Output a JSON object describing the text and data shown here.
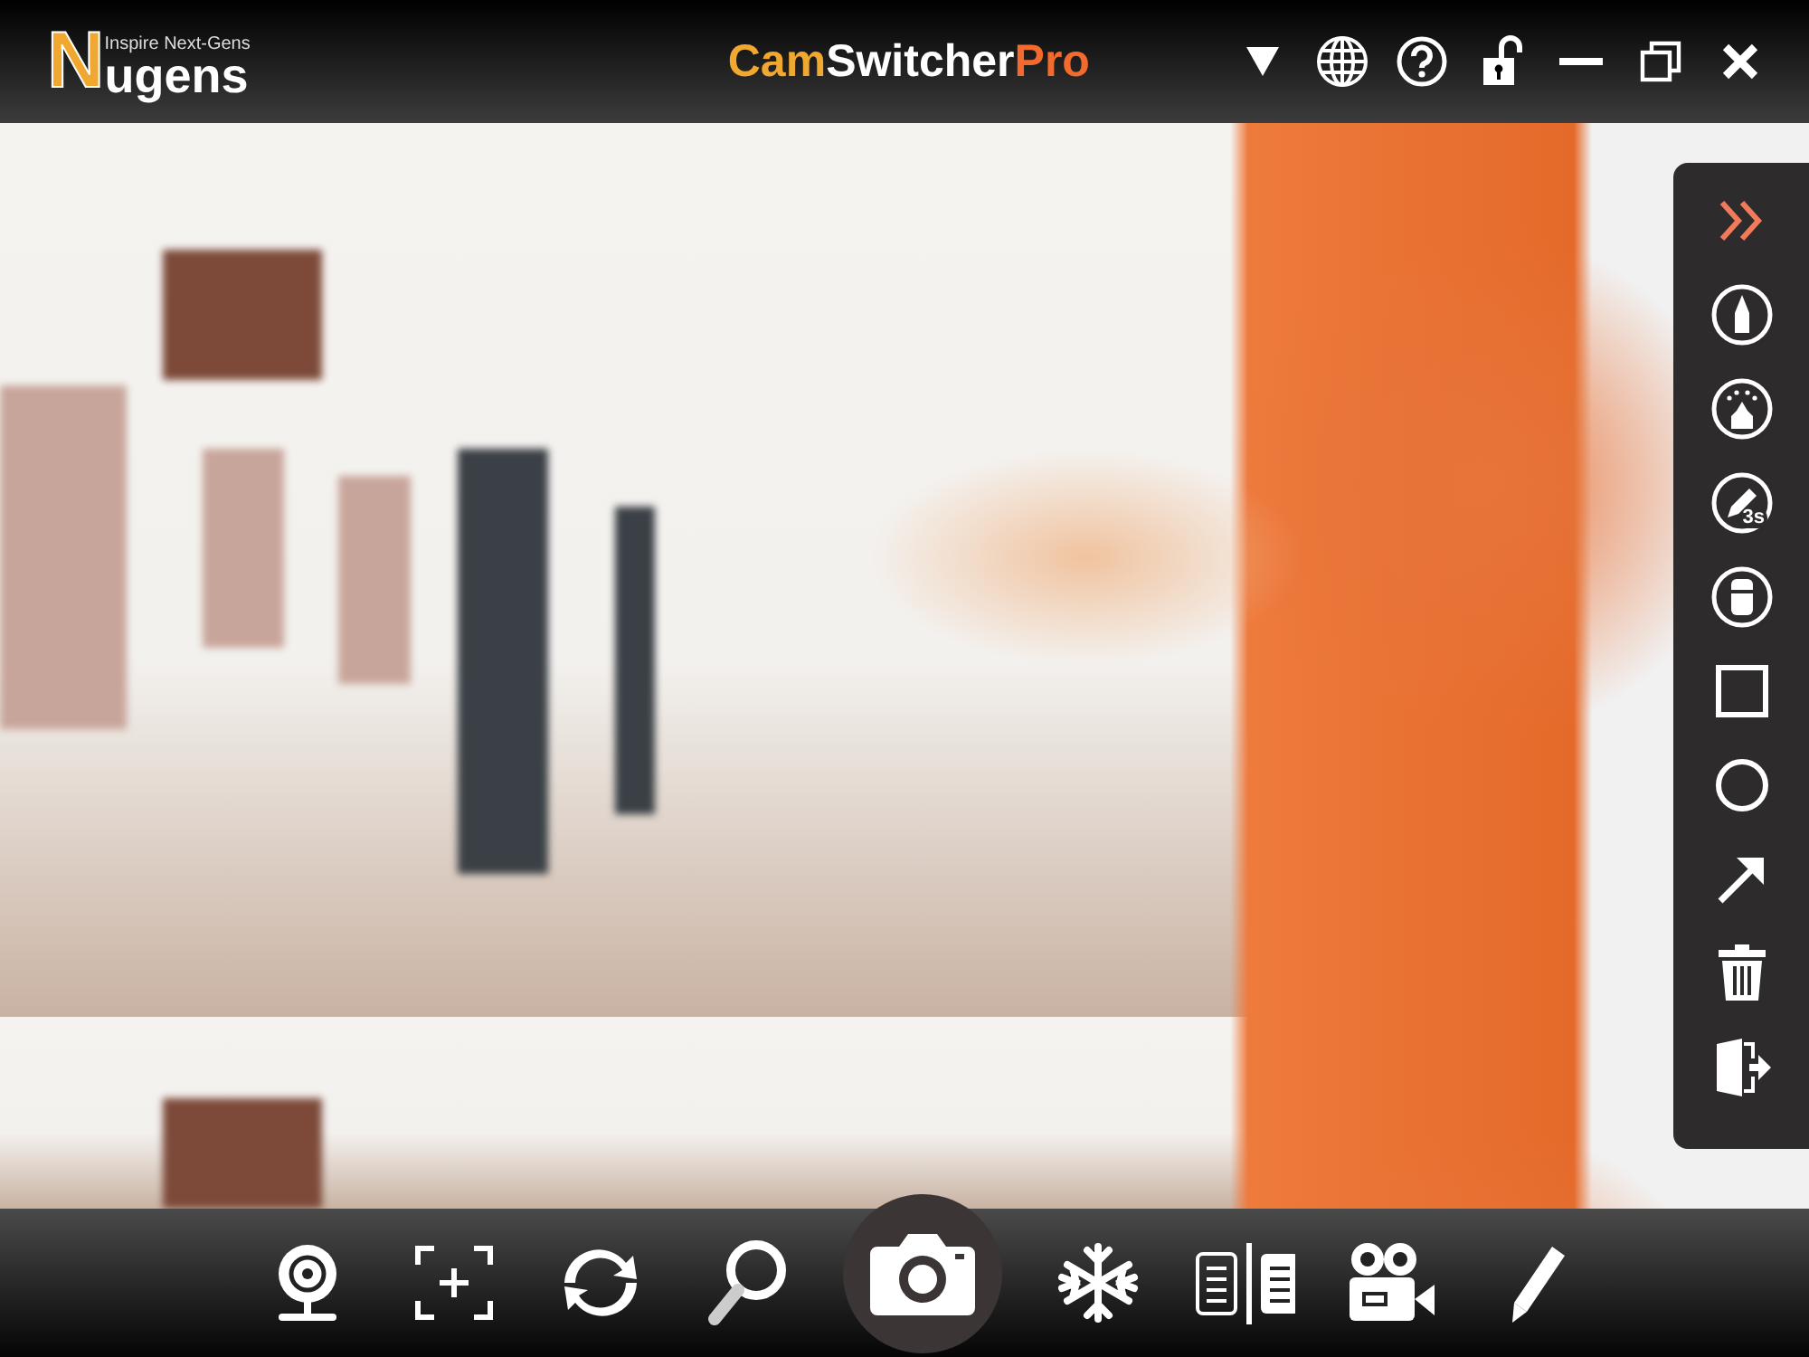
{
  "header": {
    "logo": {
      "mark": "N",
      "tagline": "Inspire Next-Gens",
      "name": "ugens"
    },
    "title_parts": [
      {
        "text": "Cam",
        "color": "#f0a830"
      },
      {
        "text": "Switcher",
        "color": "#ffffff"
      },
      {
        "text": "Pro",
        "color": "#f26a2e"
      }
    ]
  },
  "side_panel": {
    "timer_label": "3s"
  }
}
